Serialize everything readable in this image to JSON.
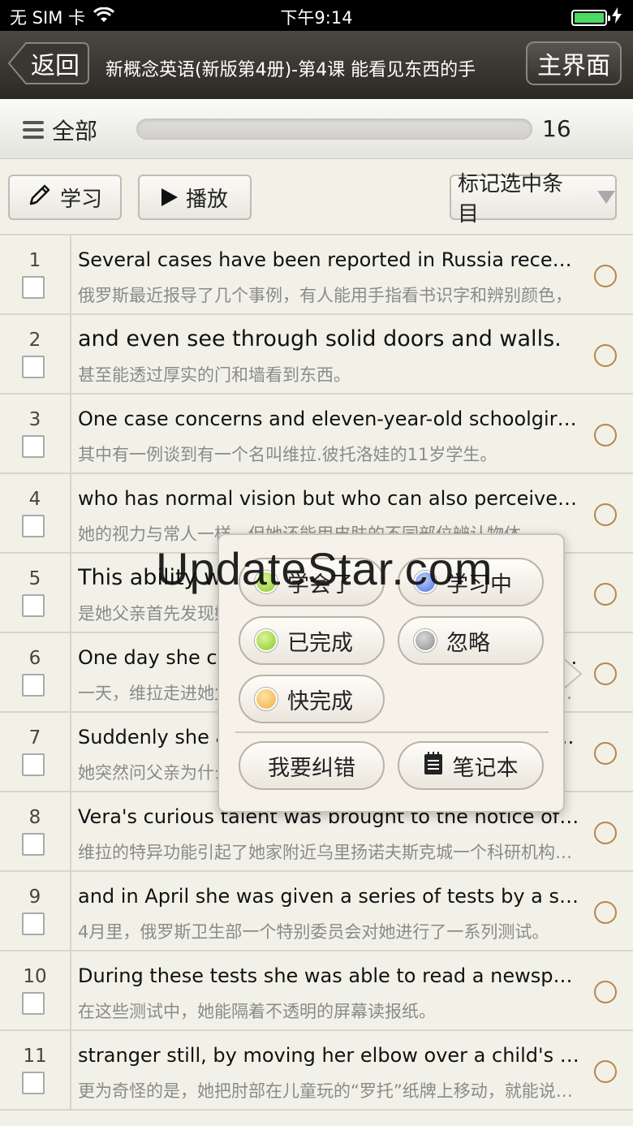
{
  "status_bar": {
    "carrier": "无 SIM 卡",
    "wifi_icon": "wifi-icon",
    "time": "下午9:14",
    "battery_icon": "battery-icon",
    "charging_icon": "charging-bolt-icon",
    "battery_level": 1.0
  },
  "nav": {
    "back_label": "返回",
    "title": "新概念英语(新版第4册)-第4课  能看见东西的手",
    "home_label": "主界面"
  },
  "filter": {
    "label": "全部",
    "count": "16"
  },
  "toolbar": {
    "study_label": "学习",
    "play_label": "播放",
    "mark_label": "标记选中条目"
  },
  "rows": [
    {
      "num": "1",
      "en": "Several cases have been reported in Russia recently of people who can read and detect colours with their fingers,",
      "cn": "俄罗斯最近报导了几个事例，有人能用手指看书识字和辨别颜色，"
    },
    {
      "num": "2",
      "en": "and even see through solid doors and walls.",
      "cn": "甚至能透过厚实的门和墙看到东西。"
    },
    {
      "num": "3",
      "en": "One case concerns and eleven-year-old schoolgirl, Vera Petrova,",
      "cn": "其中有一例谈到有一个名叫维拉.彼托洛娃的11岁学生。"
    },
    {
      "num": "4",
      "en": "who has normal vision but who can also perceive things with different parts of her skin,",
      "cn": "她的视力与常人一样，但她还能用皮肤的不同部位辨认物体，"
    },
    {
      "num": "5",
      "en": "This ability was first noticed by her father.",
      "cn": "是她父亲首先发现她有这种本领的。"
    },
    {
      "num": "6",
      "en": "One day she came into his office and happened to put her hands on the door of a locked safe.",
      "cn": "一天，维拉走进她父亲的办公室，偶然把手放到了一个锁着的保险柜门上。"
    },
    {
      "num": "7",
      "en": "Suddenly she asked her father why he kept so many old newspapers locked away there,",
      "cn": "她突然问父亲为什么把那么多旧报纸锁在保险柜里，"
    },
    {
      "num": "8",
      "en": "Vera's curious talent was brought to the notice of a scientific research institute in the town of Ulyanovsk,",
      "cn": "维拉的特异功能引起了她家附近乌里扬诺夫斯克城一个科研机构的注意，"
    },
    {
      "num": "9",
      "en": "and in April she was given a series of tests by a special commission of the Ministry of Health of the Russian Federal Republic.",
      "cn": "4月里，俄罗斯卫生部一个特别委员会对她进行了一系列测试。"
    },
    {
      "num": "10",
      "en": "During these tests she was able to read a newspaper through an opaque screen",
      "cn": "在这些测试中，她能隔着不透明的屏幕读报纸。"
    },
    {
      "num": "11",
      "en": "stranger still, by moving her elbow over a child's game of Lotto she was able to describe the figures and colours printed on it;",
      "cn": "更为奇怪的是，她把肘部在儿童玩的“罗托”纸牌上移动，就能说出牌上的数字和颜色；"
    }
  ],
  "popup": {
    "learned": "学会了",
    "learning": "学习中",
    "done": "已完成",
    "ignore": "忽略",
    "almost": "快完成",
    "correct": "我要纠错",
    "notebook": "笔记本",
    "colors": {
      "learned": "#8dc724",
      "learning": "#4d72e0",
      "done": "#8dc724",
      "ignore": "#8e8e8e",
      "almost": "#f0ae3c"
    }
  },
  "watermark": "UpdateStar.com"
}
